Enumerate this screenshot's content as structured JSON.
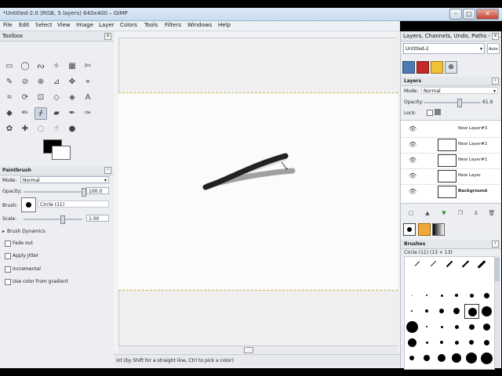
{
  "window": {
    "title": "*Untitled-2.0 (RGB, 5 layers) 640x400 – GIMP",
    "controls": {
      "minimize": "–",
      "maximize": "□",
      "close": "✕"
    }
  },
  "menu": [
    {
      "label": "File"
    },
    {
      "label": "Edit"
    },
    {
      "label": "Select"
    },
    {
      "label": "View"
    },
    {
      "label": "Image"
    },
    {
      "label": "Layer"
    },
    {
      "label": "Colors"
    },
    {
      "label": "Tools"
    },
    {
      "label": "Filters"
    },
    {
      "label": "Windows"
    },
    {
      "label": "Help"
    }
  ],
  "toolbox": {
    "title": "Toolbox",
    "tools": [
      {
        "icon": "rect-select-icon",
        "glyph": "▭"
      },
      {
        "icon": "ellipse-select-icon",
        "glyph": "◯"
      },
      {
        "icon": "lasso-icon",
        "glyph": "ᔓ"
      },
      {
        "icon": "fuzzy-select-icon",
        "glyph": "✧"
      },
      {
        "icon": "color-select-icon",
        "glyph": "▦"
      },
      {
        "icon": "scissors-icon",
        "glyph": "✄"
      },
      {
        "icon": "paths-icon",
        "glyph": "✎"
      },
      {
        "icon": "color-picker-icon",
        "glyph": "⊘"
      },
      {
        "icon": "zoom-icon",
        "glyph": "⊕"
      },
      {
        "icon": "measure-icon",
        "glyph": "⊿"
      },
      {
        "icon": "move-icon",
        "glyph": "✥"
      },
      {
        "icon": "align-icon",
        "glyph": "⌖"
      },
      {
        "icon": "crop-icon",
        "glyph": "⌗"
      },
      {
        "icon": "rotate-icon",
        "glyph": "⟳"
      },
      {
        "icon": "scale-icon",
        "glyph": "⊡"
      },
      {
        "icon": "shear-icon",
        "glyph": "◇"
      },
      {
        "icon": "perspective-icon",
        "glyph": "◈"
      },
      {
        "icon": "text-icon",
        "glyph": "A"
      },
      {
        "icon": "bucket-fill-icon",
        "glyph": "◆"
      },
      {
        "icon": "pencil-icon",
        "glyph": "✏"
      },
      {
        "icon": "paintbrush-icon",
        "glyph": "ᚋ"
      },
      {
        "icon": "eraser-icon",
        "glyph": "▰"
      },
      {
        "icon": "airbrush-icon",
        "glyph": "✒"
      },
      {
        "icon": "ink-icon",
        "glyph": "✑"
      },
      {
        "icon": "clone-icon",
        "glyph": "✿"
      },
      {
        "icon": "heal-icon",
        "glyph": "✚"
      },
      {
        "icon": "blur-icon",
        "glyph": "◌"
      },
      {
        "icon": "smudge-icon",
        "glyph": "☝"
      },
      {
        "icon": "dodge-burn-icon",
        "glyph": "●"
      }
    ],
    "options": {
      "title": "Paintbrush",
      "mode_label": "Mode:",
      "mode_value": "Normal",
      "opacity_label": "Opacity:",
      "opacity_value": "100.0",
      "opacity_level": 1.0,
      "brush_label": "Brush:",
      "brush_name": "Circle (11)",
      "scale_label": "Scale:",
      "scale_value": "1.00",
      "dynamics_label": "Brush Dynamics",
      "checkboxes": [
        "Fade out",
        "Apply Jitter",
        "Incremental",
        "Use color from gradient"
      ]
    }
  },
  "status": {
    "text": "int (by Shift for a straight line, Ctrl to pick a color)"
  },
  "dock": {
    "title": "Layers, Channels, Undo, Paths - B...",
    "image_select": "Untitled-2",
    "auto_label": "Auto",
    "layers_tab": "Layers",
    "mode_label": "Mode:",
    "mode_value": "Normal",
    "opacity_label": "Opacity:",
    "opacity_value": "61.9",
    "opacity_level": 0.619,
    "lock_label": "Lock:",
    "layers": [
      {
        "name": "New Layer#3"
      },
      {
        "name": "New Layer#2"
      },
      {
        "name": "New Layer#1"
      },
      {
        "name": "New Layer"
      },
      {
        "name": "Background"
      }
    ],
    "brushes_title": "Brushes",
    "brush_info": "Circle (11) (13 × 13)"
  },
  "colors": {
    "accent": "#c9dcef",
    "selection_border": "#c8b24a",
    "fg_color": "#000000",
    "bg_color": "#ffffff"
  }
}
